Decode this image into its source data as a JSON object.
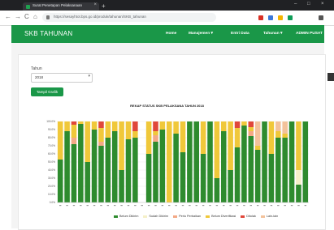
{
  "browser": {
    "tab_title": "Surat Penetapan Pelaksanaan",
    "tab_close": "×",
    "new_tab": "+",
    "url": "https://sesayhtot.bps.go.id/produk/tahunan/SKB_tahunan",
    "back_icon": "←",
    "forward_icon": "→",
    "reload_icon": "C",
    "home_icon": "⌂",
    "min_icon": "–",
    "max_icon": "□",
    "close_icon": "×",
    "ext_colors": [
      "#d93025",
      "#3c78d8",
      "#f4b400",
      "#0f9d58",
      "#555555"
    ]
  },
  "navbar": {
    "brand": "SKB TAHUNAN",
    "menu": [
      "Home",
      "Manajemen ▾",
      "Entri Data",
      "Tahunan ▾",
      "ADMIN PUSAT"
    ]
  },
  "form": {
    "year_label": "Tahun",
    "year_value": "2018",
    "show_button": "Tampil Grafik"
  },
  "chart_data": {
    "type": "bar",
    "title": "REKAP STATUS SKB PELAKSANA TAHUN 2018",
    "subtitle": "",
    "ylabel": "",
    "xlabel": "",
    "ylim": [
      0,
      100
    ],
    "yticks": [
      "100.0%",
      "90.0%",
      "80.0%",
      "70.0%",
      "60.0%",
      "50.0%",
      "40.0%",
      "30.0%",
      "20.0%",
      "10.0%",
      "0.0%"
    ],
    "colors": [
      "#2e8b2e",
      "#f5f0c8",
      "#f3a986",
      "#f0c83a",
      "#e0473a",
      "#f3c29b"
    ],
    "legend": [
      "Belum Dikirim",
      "Sudah Dikirim",
      "Perlu Perbaikan",
      "Belum Diverifikasi",
      "Ditolak",
      "Lain-lain"
    ],
    "bars": [
      [
        53,
        0,
        0,
        47,
        0,
        0
      ],
      [
        88,
        0,
        0,
        12,
        0,
        0
      ],
      [
        72,
        0,
        8,
        16,
        4,
        0
      ],
      [
        97,
        0,
        0,
        3,
        0,
        0
      ],
      [
        50,
        0,
        0,
        50,
        0,
        0
      ],
      [
        90,
        0,
        0,
        10,
        0,
        0
      ],
      [
        70,
        0,
        5,
        17,
        8,
        0
      ],
      [
        80,
        0,
        0,
        20,
        0,
        0
      ],
      [
        88,
        0,
        0,
        12,
        0,
        0
      ],
      [
        40,
        0,
        0,
        60,
        0,
        0
      ],
      [
        78,
        0,
        0,
        22,
        0,
        0
      ],
      [
        80,
        0,
        0,
        8,
        12,
        0
      ],
      [
        0,
        0,
        0,
        0,
        0,
        0
      ],
      [
        60,
        0,
        0,
        40,
        0,
        0
      ],
      [
        75,
        0,
        8,
        5,
        12,
        0
      ],
      [
        90,
        0,
        0,
        10,
        0,
        0
      ],
      [
        0,
        0,
        0,
        100,
        0,
        0
      ],
      [
        85,
        0,
        0,
        15,
        0,
        0
      ],
      [
        62,
        0,
        0,
        38,
        0,
        0
      ],
      [
        100,
        0,
        0,
        0,
        0,
        0
      ],
      [
        100,
        0,
        0,
        0,
        0,
        0
      ],
      [
        60,
        0,
        0,
        40,
        0,
        0
      ],
      [
        100,
        0,
        0,
        0,
        0,
        0
      ],
      [
        30,
        0,
        0,
        70,
        0,
        0
      ],
      [
        88,
        0,
        0,
        12,
        0,
        0
      ],
      [
        40,
        0,
        0,
        60,
        0,
        0
      ],
      [
        68,
        0,
        0,
        24,
        8,
        0
      ],
      [
        95,
        0,
        0,
        5,
        0,
        0
      ],
      [
        82,
        0,
        6,
        5,
        7,
        0
      ],
      [
        65,
        0,
        0,
        5,
        0,
        30
      ],
      [
        100,
        0,
        0,
        0,
        0,
        0
      ],
      [
        60,
        0,
        0,
        40,
        0,
        0
      ],
      [
        80,
        0,
        0,
        8,
        0,
        12
      ],
      [
        80,
        0,
        0,
        5,
        0,
        15
      ],
      [
        100,
        0,
        0,
        0,
        0,
        0
      ],
      [
        22,
        18,
        0,
        60,
        0,
        0
      ],
      [
        100,
        0,
        0,
        0,
        0,
        0
      ]
    ]
  }
}
